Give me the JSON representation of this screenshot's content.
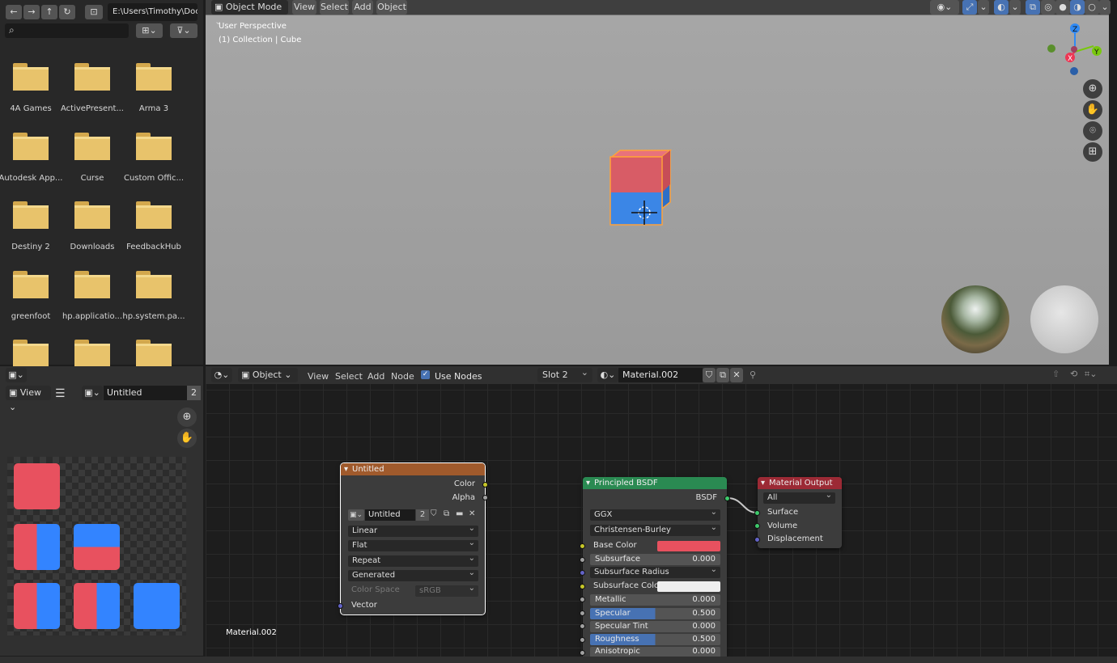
{
  "file_browser": {
    "path": "E:\\Users\\Timothy\\Doc...",
    "folders": [
      "4A Games",
      "ActivePresent...",
      "Arma 3",
      "Autodesk App...",
      "Curse",
      "Custom Offic...",
      "Destiny 2",
      "Downloads",
      "FeedbackHub",
      "greenfoot",
      "hp.applicatio...",
      "hp.system.pa..."
    ]
  },
  "viewport": {
    "header": {
      "mode": "Object Mode",
      "menus": [
        "View",
        "Select",
        "Add",
        "Object"
      ]
    },
    "overlay_line1": "User Perspective",
    "overlay_line2": "(1) Collection | Cube",
    "axes": {
      "z": "Z",
      "y": "Y",
      "x": "X"
    }
  },
  "image_editor": {
    "view": "View",
    "image_name": "Untitled",
    "users": "2",
    "tiles": [
      "red",
      "split-v",
      "split-h",
      "split-v",
      "split-v",
      "blue"
    ]
  },
  "node_editor": {
    "header": {
      "object": "Object",
      "menus": [
        "View",
        "Select",
        "Add",
        "Node"
      ],
      "use_nodes": "Use Nodes",
      "slot": "Slot 2",
      "material": "Material.002"
    },
    "material_label": "Material.002",
    "image_node": {
      "title": "Untitled",
      "out_color": "Color",
      "out_alpha": "Alpha",
      "image": "Untitled",
      "users": "2",
      "interpolation": "Linear",
      "projection": "Flat",
      "extension": "Repeat",
      "source": "Generated",
      "color_space_label": "Color Space",
      "color_space": "sRGB",
      "in_vector": "Vector"
    },
    "bsdf_node": {
      "title": "Principled BSDF",
      "out": "BSDF",
      "distribution": "GGX",
      "subsurface_method": "Christensen-Burley",
      "base_color": "Base Color",
      "subsurface": "Subsurface",
      "subsurface_val": "0.000",
      "subsurface_radius": "Subsurface Radius",
      "subsurface_color": "Subsurface Color",
      "metallic": "Metallic",
      "metallic_val": "0.000",
      "specular": "Specular",
      "specular_val": "0.500",
      "specular_tint": "Specular Tint",
      "specular_tint_val": "0.000",
      "roughness": "Roughness",
      "roughness_val": "0.500",
      "anisotropic": "Anisotropic",
      "anisotropic_val": "0.000"
    },
    "output_node": {
      "title": "Material Output",
      "target": "All",
      "surface": "Surface",
      "volume": "Volume",
      "displacement": "Displacement"
    }
  },
  "colors": {
    "red": "#e8515f",
    "blue": "#3384ff",
    "orange_header": "#a05a2c",
    "green_header": "#2a8a52",
    "red_header": "#9c2a35",
    "selection": "#ffa23a"
  }
}
